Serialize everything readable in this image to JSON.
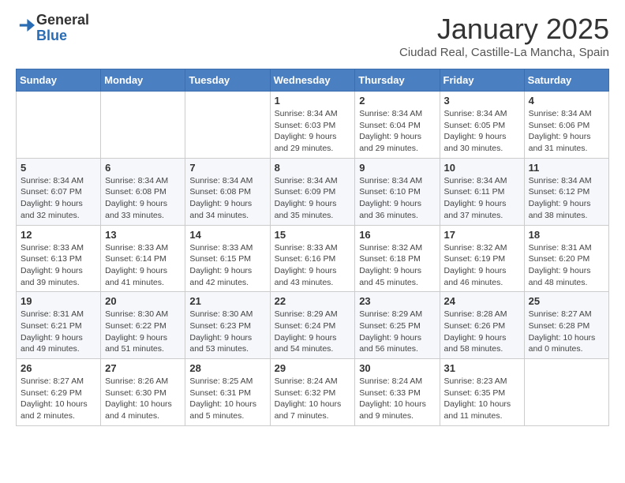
{
  "logo": {
    "general": "General",
    "blue": "Blue"
  },
  "header": {
    "month": "January 2025",
    "location": "Ciudad Real, Castille-La Mancha, Spain"
  },
  "days_of_week": [
    "Sunday",
    "Monday",
    "Tuesday",
    "Wednesday",
    "Thursday",
    "Friday",
    "Saturday"
  ],
  "weeks": [
    [
      {
        "day": "",
        "info": ""
      },
      {
        "day": "",
        "info": ""
      },
      {
        "day": "",
        "info": ""
      },
      {
        "day": "1",
        "info": "Sunrise: 8:34 AM\nSunset: 6:03 PM\nDaylight: 9 hours\nand 29 minutes."
      },
      {
        "day": "2",
        "info": "Sunrise: 8:34 AM\nSunset: 6:04 PM\nDaylight: 9 hours\nand 29 minutes."
      },
      {
        "day": "3",
        "info": "Sunrise: 8:34 AM\nSunset: 6:05 PM\nDaylight: 9 hours\nand 30 minutes."
      },
      {
        "day": "4",
        "info": "Sunrise: 8:34 AM\nSunset: 6:06 PM\nDaylight: 9 hours\nand 31 minutes."
      }
    ],
    [
      {
        "day": "5",
        "info": "Sunrise: 8:34 AM\nSunset: 6:07 PM\nDaylight: 9 hours\nand 32 minutes."
      },
      {
        "day": "6",
        "info": "Sunrise: 8:34 AM\nSunset: 6:08 PM\nDaylight: 9 hours\nand 33 minutes."
      },
      {
        "day": "7",
        "info": "Sunrise: 8:34 AM\nSunset: 6:08 PM\nDaylight: 9 hours\nand 34 minutes."
      },
      {
        "day": "8",
        "info": "Sunrise: 8:34 AM\nSunset: 6:09 PM\nDaylight: 9 hours\nand 35 minutes."
      },
      {
        "day": "9",
        "info": "Sunrise: 8:34 AM\nSunset: 6:10 PM\nDaylight: 9 hours\nand 36 minutes."
      },
      {
        "day": "10",
        "info": "Sunrise: 8:34 AM\nSunset: 6:11 PM\nDaylight: 9 hours\nand 37 minutes."
      },
      {
        "day": "11",
        "info": "Sunrise: 8:34 AM\nSunset: 6:12 PM\nDaylight: 9 hours\nand 38 minutes."
      }
    ],
    [
      {
        "day": "12",
        "info": "Sunrise: 8:33 AM\nSunset: 6:13 PM\nDaylight: 9 hours\nand 39 minutes."
      },
      {
        "day": "13",
        "info": "Sunrise: 8:33 AM\nSunset: 6:14 PM\nDaylight: 9 hours\nand 41 minutes."
      },
      {
        "day": "14",
        "info": "Sunrise: 8:33 AM\nSunset: 6:15 PM\nDaylight: 9 hours\nand 42 minutes."
      },
      {
        "day": "15",
        "info": "Sunrise: 8:33 AM\nSunset: 6:16 PM\nDaylight: 9 hours\nand 43 minutes."
      },
      {
        "day": "16",
        "info": "Sunrise: 8:32 AM\nSunset: 6:18 PM\nDaylight: 9 hours\nand 45 minutes."
      },
      {
        "day": "17",
        "info": "Sunrise: 8:32 AM\nSunset: 6:19 PM\nDaylight: 9 hours\nand 46 minutes."
      },
      {
        "day": "18",
        "info": "Sunrise: 8:31 AM\nSunset: 6:20 PM\nDaylight: 9 hours\nand 48 minutes."
      }
    ],
    [
      {
        "day": "19",
        "info": "Sunrise: 8:31 AM\nSunset: 6:21 PM\nDaylight: 9 hours\nand 49 minutes."
      },
      {
        "day": "20",
        "info": "Sunrise: 8:30 AM\nSunset: 6:22 PM\nDaylight: 9 hours\nand 51 minutes."
      },
      {
        "day": "21",
        "info": "Sunrise: 8:30 AM\nSunset: 6:23 PM\nDaylight: 9 hours\nand 53 minutes."
      },
      {
        "day": "22",
        "info": "Sunrise: 8:29 AM\nSunset: 6:24 PM\nDaylight: 9 hours\nand 54 minutes."
      },
      {
        "day": "23",
        "info": "Sunrise: 8:29 AM\nSunset: 6:25 PM\nDaylight: 9 hours\nand 56 minutes."
      },
      {
        "day": "24",
        "info": "Sunrise: 8:28 AM\nSunset: 6:26 PM\nDaylight: 9 hours\nand 58 minutes."
      },
      {
        "day": "25",
        "info": "Sunrise: 8:27 AM\nSunset: 6:28 PM\nDaylight: 10 hours\nand 0 minutes."
      }
    ],
    [
      {
        "day": "26",
        "info": "Sunrise: 8:27 AM\nSunset: 6:29 PM\nDaylight: 10 hours\nand 2 minutes."
      },
      {
        "day": "27",
        "info": "Sunrise: 8:26 AM\nSunset: 6:30 PM\nDaylight: 10 hours\nand 4 minutes."
      },
      {
        "day": "28",
        "info": "Sunrise: 8:25 AM\nSunset: 6:31 PM\nDaylight: 10 hours\nand 5 minutes."
      },
      {
        "day": "29",
        "info": "Sunrise: 8:24 AM\nSunset: 6:32 PM\nDaylight: 10 hours\nand 7 minutes."
      },
      {
        "day": "30",
        "info": "Sunrise: 8:24 AM\nSunset: 6:33 PM\nDaylight: 10 hours\nand 9 minutes."
      },
      {
        "day": "31",
        "info": "Sunrise: 8:23 AM\nSunset: 6:35 PM\nDaylight: 10 hours\nand 11 minutes."
      },
      {
        "day": "",
        "info": ""
      }
    ]
  ]
}
